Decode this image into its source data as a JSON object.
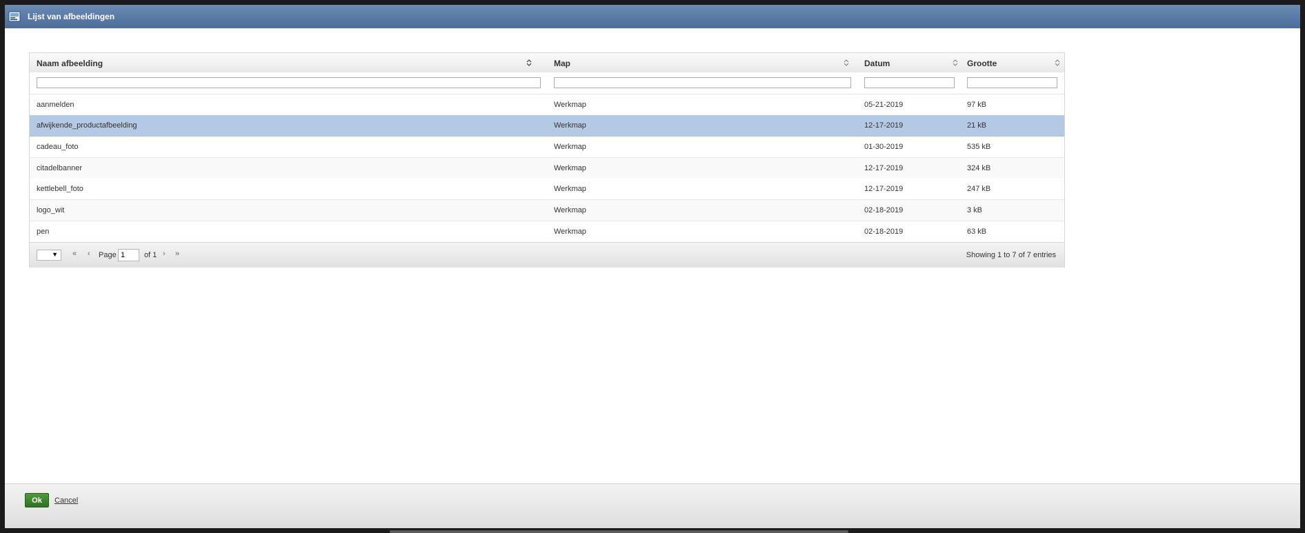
{
  "dialog": {
    "title": "Lijst van afbeeldingen",
    "icon": "image-list-icon"
  },
  "table": {
    "columns": [
      {
        "key": "name",
        "label": "Naam afbeelding"
      },
      {
        "key": "folder",
        "label": "Map"
      },
      {
        "key": "date",
        "label": "Datum"
      },
      {
        "key": "size",
        "label": "Grootte"
      }
    ],
    "filters": {
      "name": "",
      "folder": "",
      "date": "",
      "size": ""
    },
    "rows": [
      {
        "name": "aanmelden",
        "folder": "Werkmap",
        "date": "05-21-2019",
        "size": "97 kB"
      },
      {
        "name": "afwijkende_productafbeelding",
        "folder": "Werkmap",
        "date": "12-17-2019",
        "size": "21 kB",
        "selected": true
      },
      {
        "name": "cadeau_foto",
        "folder": "Werkmap",
        "date": "01-30-2019",
        "size": "535 kB"
      },
      {
        "name": "citadelbanner",
        "folder": "Werkmap",
        "date": "12-17-2019",
        "size": "324 kB"
      },
      {
        "name": "kettlebell_foto",
        "folder": "Werkmap",
        "date": "12-17-2019",
        "size": "247 kB"
      },
      {
        "name": "logo_wit",
        "folder": "Werkmap",
        "date": "02-18-2019",
        "size": "3 kB"
      },
      {
        "name": "pen",
        "folder": "Werkmap",
        "date": "02-18-2019",
        "size": "63 kB"
      }
    ]
  },
  "pager": {
    "rows_per_page": "",
    "page_label": "Page",
    "page_value": "1",
    "of_label": "of 1",
    "summary": "Showing 1 to 7 of 7 entries"
  },
  "footer": {
    "ok_label": "Ok",
    "cancel_label": "Cancel"
  },
  "colors": {
    "titlebar": "#4b6d98",
    "selected_row": "#b4c9e4",
    "ok_button": "#3b8a2e"
  }
}
